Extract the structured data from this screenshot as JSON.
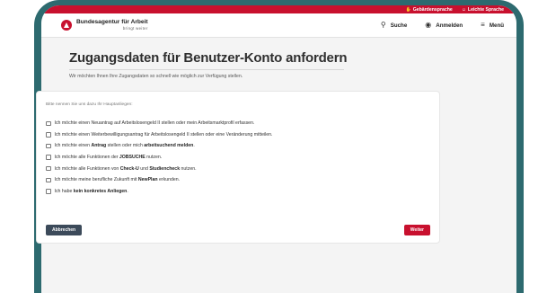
{
  "topbar": {
    "sign_language": "Gebärdensprache",
    "easy_language": "Leichte Sprache"
  },
  "header": {
    "brand_name": "Bundesagentur für Arbeit",
    "brand_claim": "bringt weiter",
    "search_label": "Suche",
    "login_label": "Anmelden",
    "menu_label": "Menü"
  },
  "main": {
    "title": "Zugangsdaten für Benutzer-Konto anfordern",
    "subtitle": "Wir möchten Ihnen Ihre Zugangsdaten so schnell wie möglich zur Verfügung stellen.",
    "prompt": "Bitte nennen Sie uns dazu Ihr Hauptanliegen:",
    "options": [
      {
        "pre": "Ich möchte einen Neuantrag auf Arbeitslosengeld II stellen oder mein Arbeitsmarktprofil erfassen.",
        "bold": "",
        "mid": "",
        "bold2": "",
        "post": ""
      },
      {
        "pre": "Ich möchte einen Weiterbewilligungsantrag für Arbeitslosengeld II stellen oder eine Veränderung mitteilen.",
        "bold": "",
        "mid": "",
        "bold2": "",
        "post": ""
      },
      {
        "pre": "Ich möchte einen ",
        "bold": "Antrag",
        "mid": " stellen oder mich ",
        "bold2": "arbeitsuchend melden",
        "post": "."
      },
      {
        "pre": "Ich möchte alle Funktionen der ",
        "bold": "JOBSUCHE",
        "mid": " nutzen.",
        "bold2": "",
        "post": ""
      },
      {
        "pre": "Ich möchte alle Funktionen von ",
        "bold": "Check-U",
        "mid": " und ",
        "bold2": "Studiencheck",
        "post": " nutzen."
      },
      {
        "pre": "Ich möchte meine berufliche Zukunft mit ",
        "bold": "NewPlan",
        "mid": " erkunden.",
        "bold2": "",
        "post": ""
      },
      {
        "pre": "Ich habe ",
        "bold": "kein konkretes Anliegen",
        "mid": ".",
        "bold2": "",
        "post": ""
      }
    ],
    "cancel_label": "Abbrechen",
    "next_label": "Weiter"
  },
  "colors": {
    "brand_red": "#c8102e",
    "frame_teal": "#2d6a6f",
    "cancel_dark": "#3c4a5a"
  },
  "icons": {
    "sign_language": "hand-icon",
    "easy_language": "person-icon",
    "search": "search-icon",
    "login": "user-icon",
    "menu": "hamburger-icon"
  }
}
